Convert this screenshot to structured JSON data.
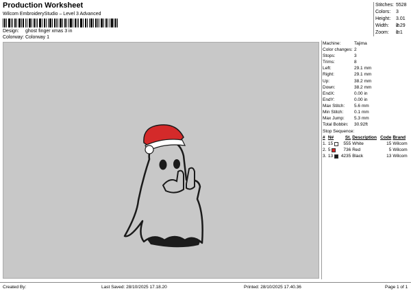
{
  "header": {
    "title": "Production Worksheet",
    "subtitle": "Wilcom EmbroideryStudio – Level 3 Advanced",
    "design_label": "Design:",
    "design_value": "ghost finger xmas 3 in",
    "colorway_label": "Colorway:",
    "colorway_value": "Colorway 1"
  },
  "stats": [
    {
      "label": "Stitches:",
      "value": "5528"
    },
    {
      "label": "Colors:",
      "value": "3"
    },
    {
      "label": "Height:",
      "value": "3.01 in"
    },
    {
      "label": "Width:",
      "value": "2.29 in"
    },
    {
      "label": "Zoom:",
      "value": "1:1"
    }
  ],
  "properties": [
    {
      "label": "Machine:",
      "value": "Tajima"
    },
    {
      "label": "Color changes:",
      "value": "2"
    },
    {
      "label": "Stops:",
      "value": "3"
    },
    {
      "label": "Trims:",
      "value": "8"
    },
    {
      "label": "Left:",
      "value": "29.1 mm"
    },
    {
      "label": "Right:",
      "value": "29.1 mm"
    },
    {
      "label": "Up:",
      "value": "38.2 mm"
    },
    {
      "label": "Down:",
      "value": "38.2 mm"
    },
    {
      "label": "EndX:",
      "value": "0.00 in"
    },
    {
      "label": "EndY:",
      "value": "0.00 in"
    },
    {
      "label": "Max Stitch:",
      "value": "5.6 mm"
    },
    {
      "label": "Min Stitch:",
      "value": "0.1 mm"
    },
    {
      "label": "Max Jump:",
      "value": "5.3 mm"
    },
    {
      "label": "Total Bobbin:",
      "value": "30.92ft"
    }
  ],
  "stop_sequence": {
    "title": "Stop Sequence:",
    "headers": {
      "num": "#",
      "n": "N#",
      "st": "St.",
      "description": "Description",
      "code": "Code",
      "brand": "Brand"
    },
    "rows": [
      {
        "num": "1.",
        "n": "15",
        "color": "#ffffff",
        "st": "555",
        "description": "White",
        "code": "15",
        "brand": "Wilcom"
      },
      {
        "num": "2.",
        "n": "5",
        "color": "#d42a2a",
        "st": "736",
        "description": "Red",
        "code": "5",
        "brand": "Wilcom"
      },
      {
        "num": "3.",
        "n": "13",
        "color": "#1a1a1a",
        "st": "4235",
        "description": "Black",
        "code": "13",
        "brand": "Wilcom"
      }
    ]
  },
  "footer": {
    "created_by": "Created By:",
    "last_saved": "Last Saved: 28/10/2025 17.18.20",
    "printed": "Printed: 28/10/2025 17.40.36",
    "page": "Page 1 of 1"
  },
  "colors": {
    "canvas_bg": "#c8c8c8",
    "thread_white": "#ffffff",
    "thread_red": "#d42a2a",
    "thread_black": "#1a1a1a"
  }
}
